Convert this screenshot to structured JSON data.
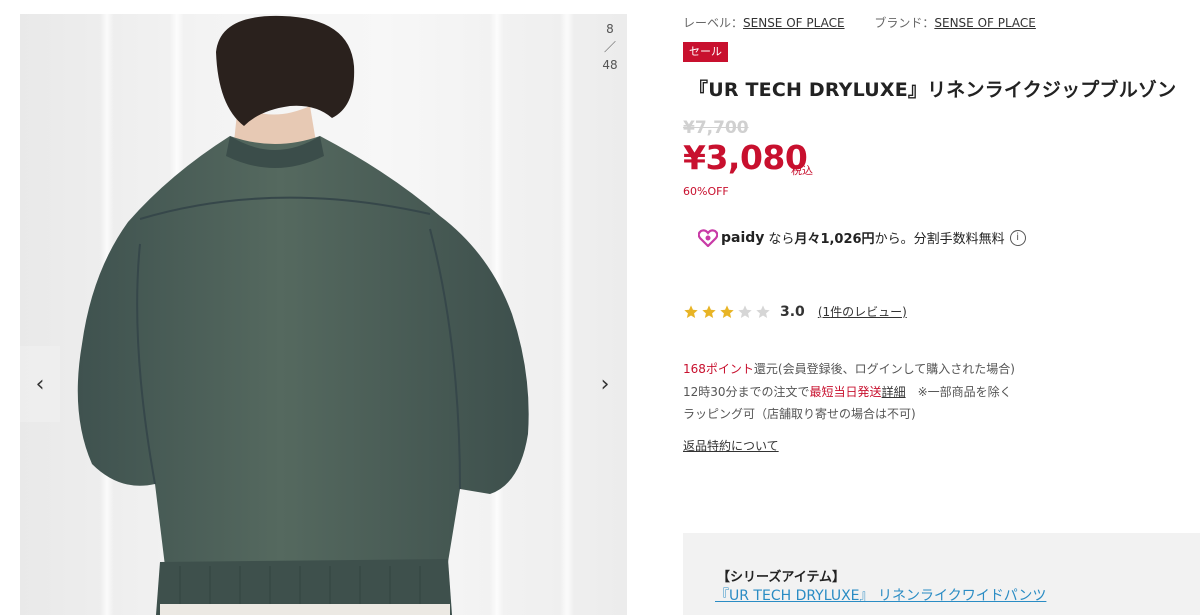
{
  "gallery": {
    "current": "8",
    "separator": "／",
    "total": "48",
    "prev_symbol": "‹",
    "next_symbol": "›",
    "jacket_color": "#4b5e5a"
  },
  "product": {
    "label_prefix": "レーベル：",
    "label_name": "SENSE OF PLACE",
    "brand_prefix": "ブランド：",
    "brand_name": "SENSE OF PLACE",
    "sale_badge": "セール",
    "title": "『UR TECH DRYLUXE』リネンライクジップブルゾン",
    "old_price": "¥7,700",
    "price": "¥3,080",
    "tax_label": "税込",
    "discount": "60%OFF"
  },
  "paidy": {
    "logo_text": "paidy",
    "text_before": "なら",
    "text_bold": "月々1,026円",
    "text_after": "から。分割手数料無料",
    "info_symbol": "i"
  },
  "rating": {
    "score": "3.0",
    "stars_filled": 3,
    "stars_total": 5,
    "review_count": "1",
    "review_link_suffix": "件のレビュー)",
    "review_link_prefix": "("
  },
  "notes": {
    "points_value": "168ポイント",
    "points_text": "還元(会員登録後、ログインして購入された場合)",
    "shipping_prefix": "12時30分までの注文で",
    "shipping_red": "最短当日発送",
    "shipping_link": "詳細",
    "shipping_suffix": "　※一部商品を除く",
    "wrapping": "ラッピング可（店舗取り寄せの場合は不可)",
    "return_policy": "返品特約について"
  },
  "series": {
    "title": "【シリーズアイテム】",
    "link": "『UR TECH DRYLUXE』 リネンライクワイドパンツ"
  },
  "colors": {
    "accent_red": "#c8102e",
    "star_gold": "#e8b425",
    "star_empty": "#d6d6d6",
    "link_blue": "#2a8cc4",
    "paidy_pink": "#c83aa6"
  }
}
